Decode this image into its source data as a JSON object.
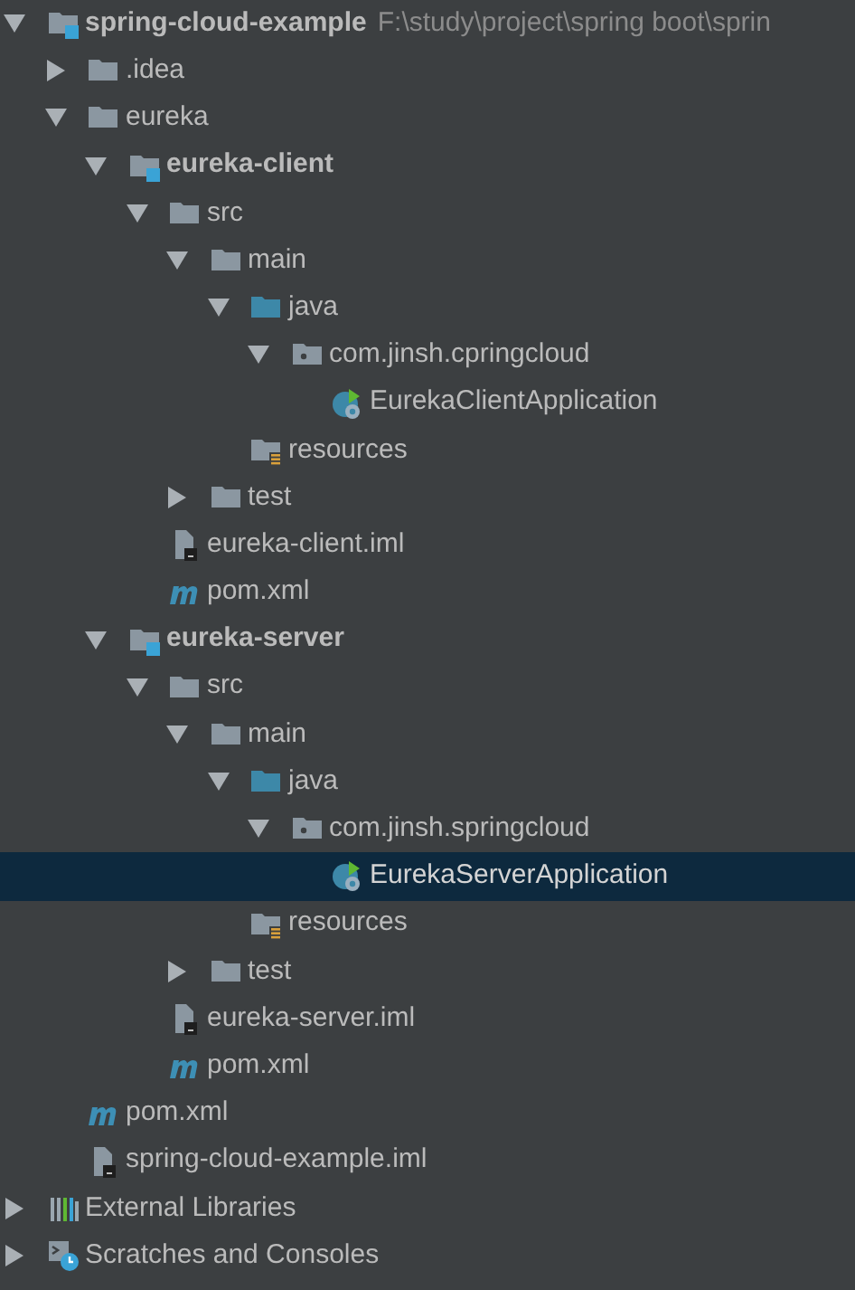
{
  "project_tree": [
    {
      "kind": "module",
      "label": "spring-cloud-example",
      "path": "F:\\study\\project\\spring boot\\sprin",
      "expanded": true,
      "selected": false,
      "children": [
        {
          "kind": "folder",
          "label": ".idea",
          "expanded": false,
          "selected": false
        },
        {
          "kind": "folder",
          "label": "eureka",
          "expanded": true,
          "selected": false,
          "children": [
            {
              "kind": "module",
              "label": "eureka-client",
              "expanded": true,
              "selected": false,
              "children": [
                {
                  "kind": "folder",
                  "label": "src",
                  "expanded": true,
                  "selected": false,
                  "children": [
                    {
                      "kind": "folder",
                      "label": "main",
                      "expanded": true,
                      "selected": false,
                      "children": [
                        {
                          "kind": "source",
                          "label": "java",
                          "expanded": true,
                          "selected": false,
                          "children": [
                            {
                              "kind": "package",
                              "label": "com.jinsh.cpringcloud",
                              "expanded": true,
                              "selected": false,
                              "children": [
                                {
                                  "kind": "spring-class",
                                  "label": "EurekaClientApplication",
                                  "selected": false
                                }
                              ]
                            }
                          ]
                        },
                        {
                          "kind": "resources",
                          "label": "resources",
                          "selected": false
                        }
                      ]
                    },
                    {
                      "kind": "folder",
                      "label": "test",
                      "expanded": false,
                      "selected": false
                    }
                  ]
                },
                {
                  "kind": "iml",
                  "label": "eureka-client.iml",
                  "selected": false
                },
                {
                  "kind": "maven",
                  "label": "pom.xml",
                  "selected": false
                }
              ]
            },
            {
              "kind": "module",
              "label": "eureka-server",
              "expanded": true,
              "selected": false,
              "children": [
                {
                  "kind": "folder",
                  "label": "src",
                  "expanded": true,
                  "selected": false,
                  "children": [
                    {
                      "kind": "folder",
                      "label": "main",
                      "expanded": true,
                      "selected": false,
                      "children": [
                        {
                          "kind": "source",
                          "label": "java",
                          "expanded": true,
                          "selected": false,
                          "children": [
                            {
                              "kind": "package",
                              "label": "com.jinsh.springcloud",
                              "expanded": true,
                              "selected": false,
                              "children": [
                                {
                                  "kind": "spring-class",
                                  "label": "EurekaServerApplication",
                                  "selected": true
                                }
                              ]
                            }
                          ]
                        },
                        {
                          "kind": "resources",
                          "label": "resources",
                          "selected": false
                        }
                      ]
                    },
                    {
                      "kind": "folder",
                      "label": "test",
                      "expanded": false,
                      "selected": false
                    }
                  ]
                },
                {
                  "kind": "iml",
                  "label": "eureka-server.iml",
                  "selected": false
                },
                {
                  "kind": "maven",
                  "label": "pom.xml",
                  "selected": false
                }
              ]
            }
          ]
        },
        {
          "kind": "maven",
          "label": "pom.xml",
          "selected": false
        },
        {
          "kind": "iml",
          "label": "spring-cloud-example.iml",
          "selected": false
        }
      ]
    },
    {
      "kind": "libraries",
      "label": "External Libraries",
      "expanded": false,
      "selected": false
    },
    {
      "kind": "scratches",
      "label": "Scratches and Consoles",
      "expanded": false,
      "selected": false
    }
  ]
}
